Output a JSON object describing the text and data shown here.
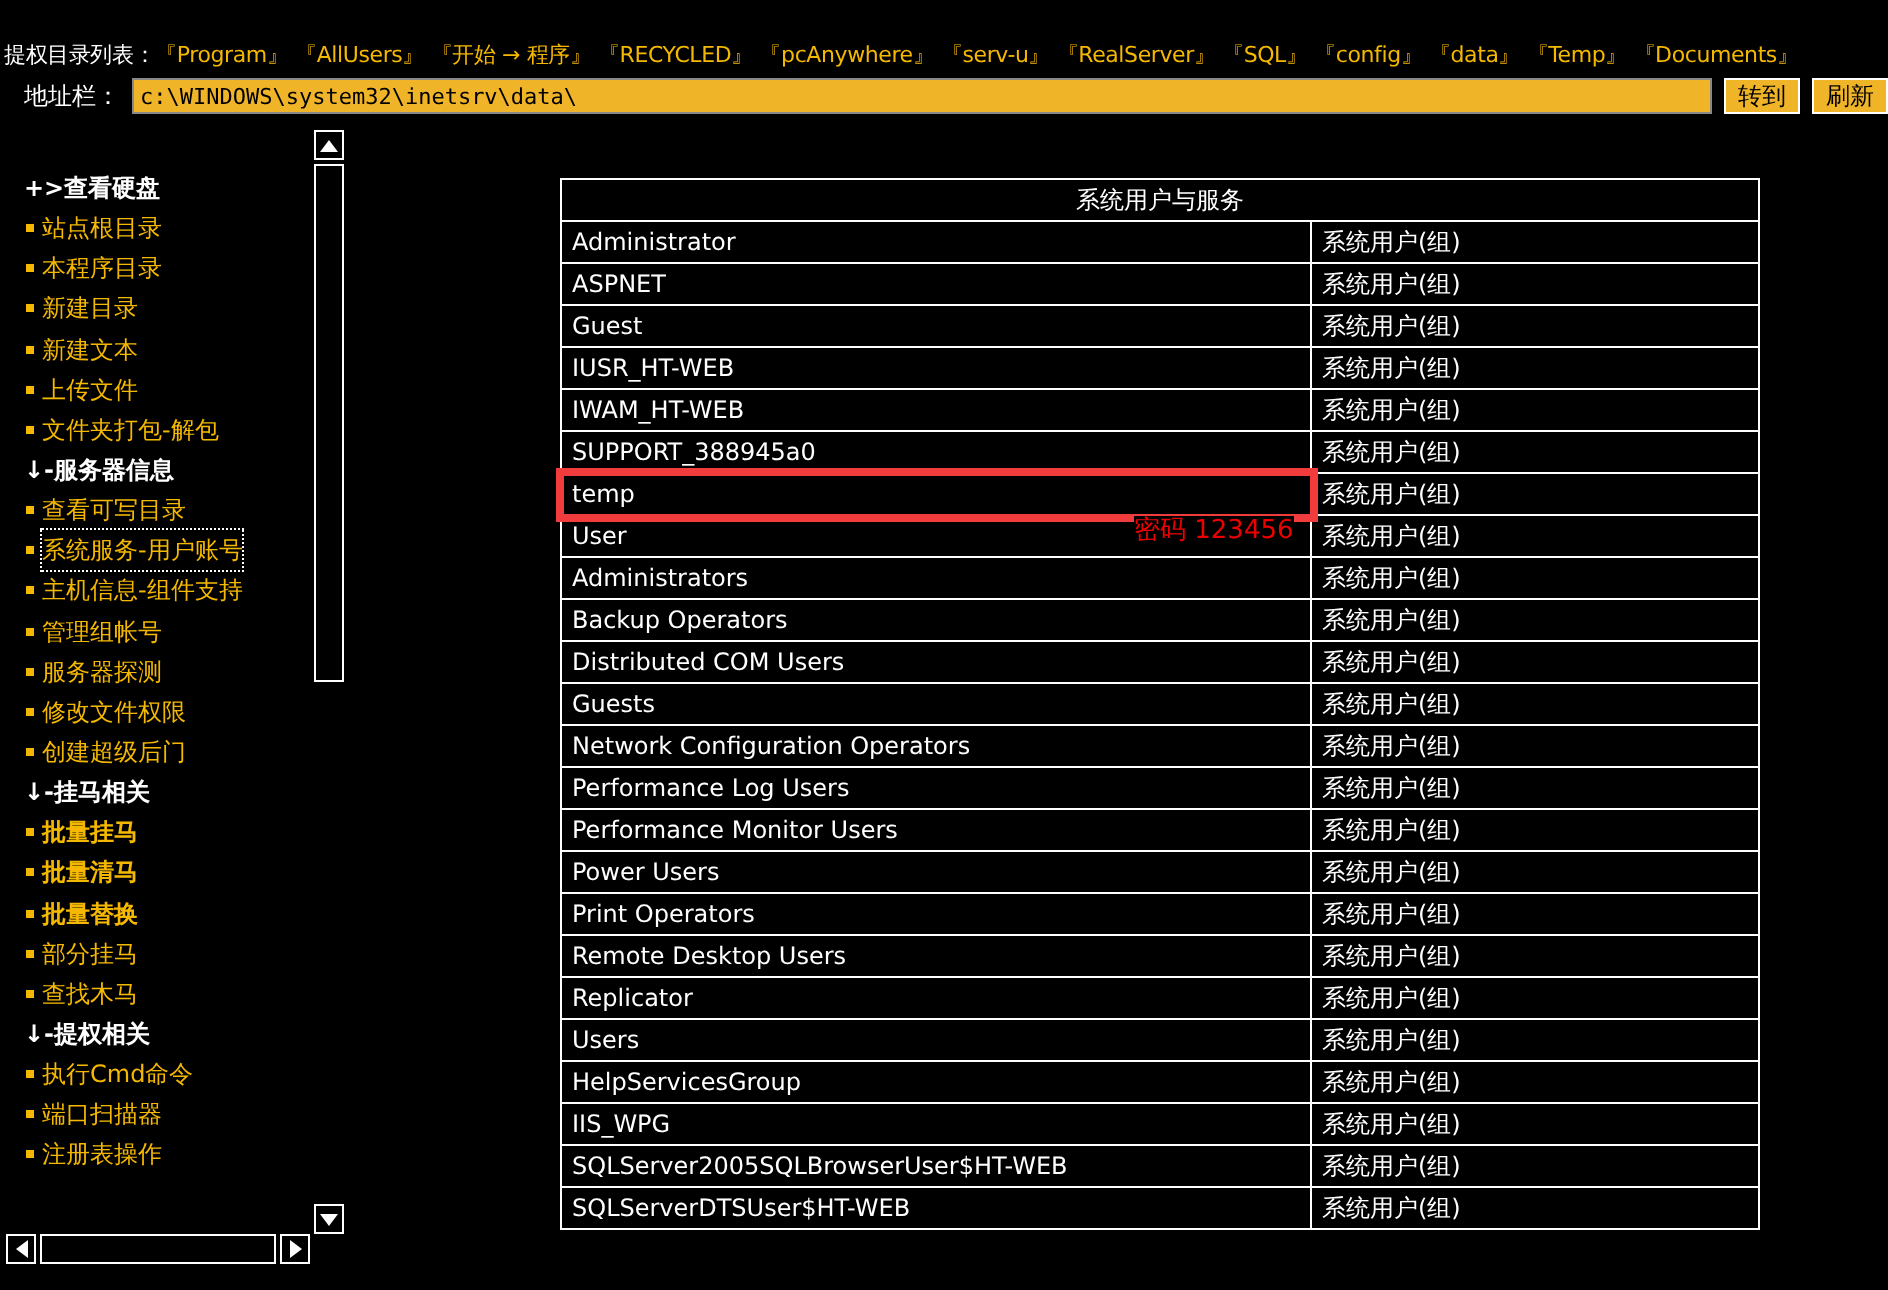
{
  "top_bar": {
    "label": "提权目录列表：",
    "links": [
      "『Program』",
      "『AllUsers』",
      "『开始 → 程序』",
      "『RECYCLED』",
      "『pcAnywhere』",
      "『serv-u』",
      "『RealServer』",
      "『SQL』",
      "『config』",
      "『data』",
      "『Temp』",
      "『Documents』"
    ]
  },
  "address_bar": {
    "label": "地址栏：",
    "value": "c:\\WINDOWS\\system32\\inetsrv\\data\\",
    "buttons": [
      "转到",
      "刷新"
    ]
  },
  "sidebar": {
    "items": [
      {
        "kind": "head",
        "prefix": "+>",
        "label": "查看硬盘"
      },
      {
        "kind": "link",
        "label": "站点根目录",
        "bold": false,
        "focused": false
      },
      {
        "kind": "link",
        "label": "本程序目录",
        "bold": false,
        "focused": false
      },
      {
        "kind": "link",
        "label": "新建目录",
        "bold": false,
        "focused": false
      },
      {
        "kind": "link",
        "label": "新建文本",
        "bold": false,
        "focused": false
      },
      {
        "kind": "link",
        "label": "上传文件",
        "bold": false,
        "focused": false
      },
      {
        "kind": "link",
        "label": "文件夹打包-解包",
        "bold": false,
        "focused": false
      },
      {
        "kind": "head",
        "prefix": "↓-",
        "label": "服务器信息"
      },
      {
        "kind": "link",
        "label": "查看可写目录",
        "bold": false,
        "focused": false
      },
      {
        "kind": "link",
        "label": "系统服务-用户账号",
        "bold": false,
        "focused": true
      },
      {
        "kind": "link",
        "label": "主机信息-组件支持",
        "bold": false,
        "focused": false
      },
      {
        "kind": "link",
        "label": "管理组帐号",
        "bold": false,
        "focused": false
      },
      {
        "kind": "link",
        "label": "服务器探测",
        "bold": false,
        "focused": false
      },
      {
        "kind": "link",
        "label": "修改文件权限",
        "bold": false,
        "focused": false
      },
      {
        "kind": "link",
        "label": "创建超级后门",
        "bold": false,
        "focused": false
      },
      {
        "kind": "head",
        "prefix": "↓-",
        "label": "挂马相关"
      },
      {
        "kind": "link",
        "label": "批量挂马",
        "bold": true,
        "focused": false
      },
      {
        "kind": "link",
        "label": "批量清马",
        "bold": true,
        "focused": false
      },
      {
        "kind": "link",
        "label": "批量替换",
        "bold": true,
        "focused": false
      },
      {
        "kind": "link",
        "label": "部分挂马",
        "bold": false,
        "focused": false
      },
      {
        "kind": "link",
        "label": "查找木马",
        "bold": false,
        "focused": false
      },
      {
        "kind": "head",
        "prefix": "↓-",
        "label": "提权相关"
      },
      {
        "kind": "link",
        "label": "执行Cmd命令",
        "bold": false,
        "focused": false
      },
      {
        "kind": "link",
        "label": "端口扫描器",
        "bold": false,
        "focused": false
      },
      {
        "kind": "link",
        "label": "注册表操作",
        "bold": false,
        "focused": false
      }
    ]
  },
  "table": {
    "title": "系统用户与服务",
    "rows": [
      {
        "name": "Administrator",
        "type": "系统用户(组)",
        "highlighted": false
      },
      {
        "name": "ASPNET",
        "type": "系统用户(组)",
        "highlighted": false
      },
      {
        "name": "Guest",
        "type": "系统用户(组)",
        "highlighted": false
      },
      {
        "name": "IUSR_HT-WEB",
        "type": "系统用户(组)",
        "highlighted": false
      },
      {
        "name": "IWAM_HT-WEB",
        "type": "系统用户(组)",
        "highlighted": false
      },
      {
        "name": "SUPPORT_388945a0",
        "type": "系统用户(组)",
        "highlighted": false
      },
      {
        "name": "temp",
        "type": "系统用户(组)",
        "highlighted": true
      },
      {
        "name": "User",
        "type": "系统用户(组)",
        "highlighted": false
      },
      {
        "name": "Administrators",
        "type": "系统用户(组)",
        "highlighted": false
      },
      {
        "name": "Backup Operators",
        "type": "系统用户(组)",
        "highlighted": false
      },
      {
        "name": "Distributed COM Users",
        "type": "系统用户(组)",
        "highlighted": false
      },
      {
        "name": "Guests",
        "type": "系统用户(组)",
        "highlighted": false
      },
      {
        "name": "Network Configuration Operators",
        "type": "系统用户(组)",
        "highlighted": false
      },
      {
        "name": "Performance Log Users",
        "type": "系统用户(组)",
        "highlighted": false
      },
      {
        "name": "Performance Monitor Users",
        "type": "系统用户(组)",
        "highlighted": false
      },
      {
        "name": "Power Users",
        "type": "系统用户(组)",
        "highlighted": false
      },
      {
        "name": "Print Operators",
        "type": "系统用户(组)",
        "highlighted": false
      },
      {
        "name": "Remote Desktop Users",
        "type": "系统用户(组)",
        "highlighted": false
      },
      {
        "name": "Replicator",
        "type": "系统用户(组)",
        "highlighted": false
      },
      {
        "name": "Users",
        "type": "系统用户(组)",
        "highlighted": false
      },
      {
        "name": "HelpServicesGroup",
        "type": "系统用户(组)",
        "highlighted": false
      },
      {
        "name": "IIS_WPG",
        "type": "系统用户(组)",
        "highlighted": false
      },
      {
        "name": "SQLServer2005SQLBrowserUser$HT-WEB",
        "type": "系统用户(组)",
        "highlighted": false
      },
      {
        "name": "SQLServerDTSUser$HT-WEB",
        "type": "系统用户(组)",
        "highlighted": false
      }
    ]
  },
  "annotation": {
    "text": "密码 123456"
  }
}
